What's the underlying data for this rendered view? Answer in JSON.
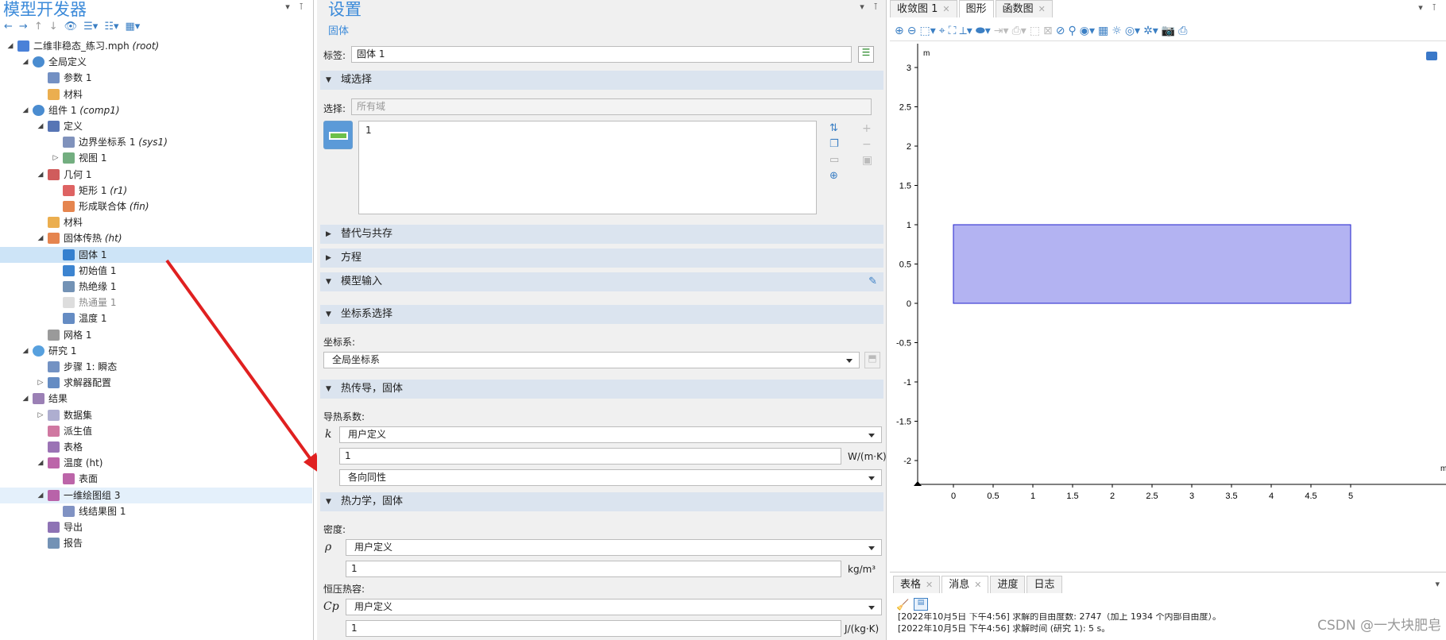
{
  "left": {
    "title": "模型开发器",
    "tree": [
      {
        "label": "二维非稳态_练习.mph",
        "tag": "(root)",
        "icon": "model-icon"
      },
      {
        "label": "全局定义",
        "tag": "",
        "icon": "globe-icon"
      },
      {
        "label": "参数 1",
        "tag": "",
        "icon": "parameters-icon"
      },
      {
        "label": "材料",
        "tag": "",
        "icon": "materials-icon"
      },
      {
        "label": "组件 1",
        "tag": "(comp1)",
        "icon": "component-icon"
      },
      {
        "label": "定义",
        "tag": "",
        "icon": "definitions-icon"
      },
      {
        "label": "边界坐标系 1",
        "tag": "(sys1)",
        "icon": "coordinate-system-icon"
      },
      {
        "label": "视图 1",
        "tag": "",
        "icon": "view-icon"
      },
      {
        "label": "几何 1",
        "tag": "",
        "icon": "geometry-icon"
      },
      {
        "label": "矩形 1",
        "tag": "(r1)",
        "icon": "rectangle-icon"
      },
      {
        "label": "形成联合体",
        "tag": "(fin)",
        "icon": "form-union-icon"
      },
      {
        "label": "材料",
        "tag": "",
        "icon": "materials-icon"
      },
      {
        "label": "固体传热",
        "tag": "(ht)",
        "icon": "heat-transfer-icon"
      },
      {
        "label": "固体 1",
        "tag": "",
        "icon": "solid-icon"
      },
      {
        "label": "初始值 1",
        "tag": "",
        "icon": "initial-values-icon"
      },
      {
        "label": "热绝缘 1",
        "tag": "",
        "icon": "thermal-insulation-icon"
      },
      {
        "label": "热通量 1",
        "tag": "",
        "icon": "heat-flux-icon"
      },
      {
        "label": "温度 1",
        "tag": "",
        "icon": "temperature-icon"
      },
      {
        "label": "网格 1",
        "tag": "",
        "icon": "mesh-icon"
      },
      {
        "label": "研究 1",
        "tag": "",
        "icon": "study-icon"
      },
      {
        "label": "步骤 1: 瞬态",
        "tag": "",
        "icon": "time-dependent-icon"
      },
      {
        "label": "求解器配置",
        "tag": "",
        "icon": "solver-icon"
      },
      {
        "label": "结果",
        "tag": "",
        "icon": "results-icon"
      },
      {
        "label": "数据集",
        "tag": "",
        "icon": "datasets-icon"
      },
      {
        "label": "派生值",
        "tag": "",
        "icon": "derived-values-icon"
      },
      {
        "label": "表格",
        "tag": "",
        "icon": "tables-icon"
      },
      {
        "label": "温度 (ht)",
        "tag": "",
        "icon": "plot-group-icon"
      },
      {
        "label": "表面",
        "tag": "",
        "icon": "surface-icon"
      },
      {
        "label": "一维绘图组 3",
        "tag": "",
        "icon": "1d-plot-icon"
      },
      {
        "label": "线结果图 1",
        "tag": "",
        "icon": "line-graph-icon"
      },
      {
        "label": "导出",
        "tag": "",
        "icon": "export-icon"
      },
      {
        "label": "报告",
        "tag": "",
        "icon": "report-icon"
      }
    ]
  },
  "settings": {
    "title": "设置",
    "subtitle": "固体",
    "label_caption": "标签:",
    "label_value": "固体 1",
    "domain_section": "域选择",
    "selection_caption": "选择:",
    "selection_value": "所有域",
    "selection_list_item": "1",
    "override_section": "替代与共存",
    "equation_section": "方程",
    "model_input_section": "模型输入",
    "coord_section": "坐标系选择",
    "coord_caption": "坐标系:",
    "coord_value": "全局坐标系",
    "heat_cond_section": "热传导，固体",
    "thermal_cond_caption": "导热系数:",
    "k_symbol": "k",
    "k_source": "用户定义",
    "k_value": "1",
    "k_unit": "W/(m·K)",
    "k_type": "各向同性",
    "thermo_section": "热力学，固体",
    "density_caption": "密度:",
    "rho_symbol": "ρ",
    "rho_source": "用户定义",
    "rho_value": "1",
    "rho_unit": "kg/m³",
    "cp_caption": "恒压热容:",
    "cp_symbol": "Cp",
    "cp_source": "用户定义",
    "cp_value": "1",
    "cp_unit": "J/(kg·K)"
  },
  "graphics": {
    "tabs": [
      "收敛图 1",
      "图形",
      "函数图"
    ],
    "active_tab": "图形",
    "axis_unit_y": "m",
    "axis_unit_x": "m",
    "x_ticks": [
      "0",
      "0.5",
      "1",
      "1.5",
      "2",
      "2.5",
      "3",
      "3.5",
      "4",
      "4.5",
      "5"
    ],
    "y_ticks": [
      "3",
      "2.5",
      "2",
      "1.5",
      "1",
      "0.5",
      "0",
      "-0.5",
      "-1",
      "-1.5",
      "-2"
    ],
    "domain_fill": "#b3b3f2",
    "domain_stroke": "#2222cc"
  },
  "messages": {
    "tabs": [
      "表格",
      "消息",
      "进度",
      "日志"
    ],
    "active_tab": "消息",
    "lines": [
      "[2022年10月5日 下午4:56] 求解的自由度数: 2747（加上 1934 个内部自由度）。",
      "[2022年10月5日 下午4:56] 求解时间 (研究 1): 5 s。"
    ]
  },
  "watermark": "CSDN @一大块肥皂"
}
